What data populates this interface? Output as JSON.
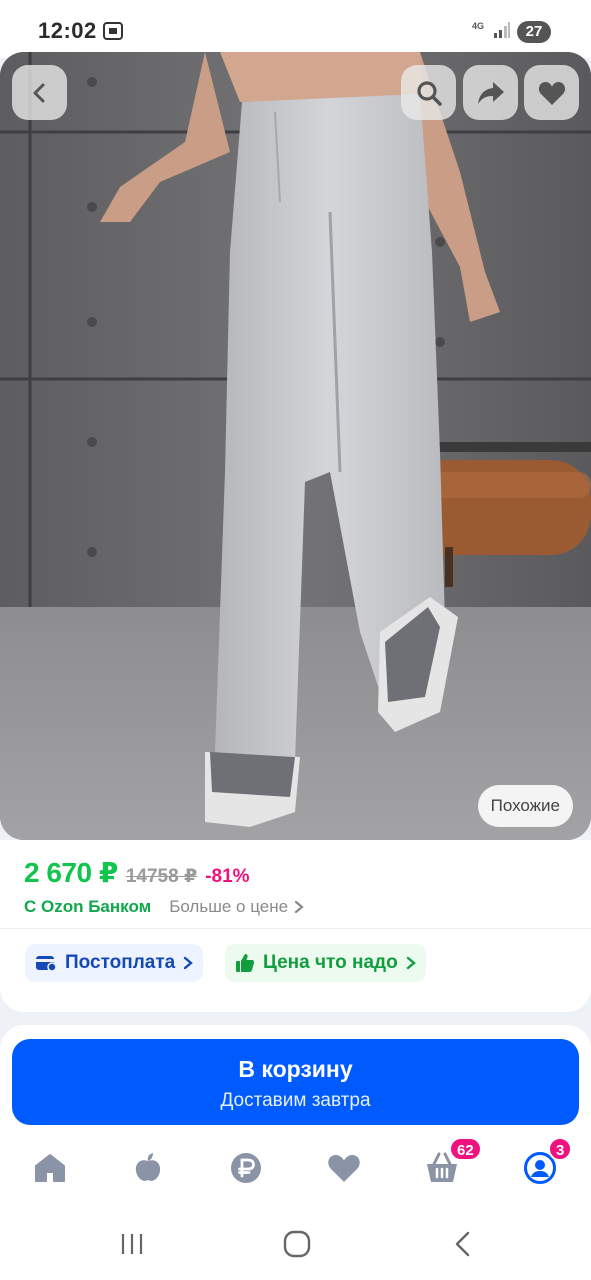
{
  "status_bar": {
    "time": "12:02",
    "network": "4G",
    "battery": "27"
  },
  "product": {
    "similar_label": "Похожие",
    "icons": [
      "back-icon",
      "search-icon",
      "share-icon",
      "heart-icon"
    ]
  },
  "price": {
    "current": "2 670 ₽",
    "old": "14758 ₽",
    "discount": "-81%",
    "bank_label": "С Ozon Банком",
    "more_label": "Больше о цене"
  },
  "chips": {
    "postpay": "Постоплата",
    "price_good": "Цена что надо"
  },
  "cart": {
    "title": "В корзину",
    "subtitle": "Доставим завтра"
  },
  "bottom_nav": {
    "items": [
      {
        "icon": "home-icon"
      },
      {
        "icon": "fresh-icon"
      },
      {
        "icon": "ruble-icon"
      },
      {
        "icon": "heart-icon"
      },
      {
        "icon": "cart-icon",
        "badge": "62"
      },
      {
        "icon": "profile-icon",
        "badge": "3"
      }
    ]
  },
  "colors": {
    "accent_blue": "#005bff",
    "price_green": "#10c44c",
    "discount_pink": "#f1117e"
  }
}
